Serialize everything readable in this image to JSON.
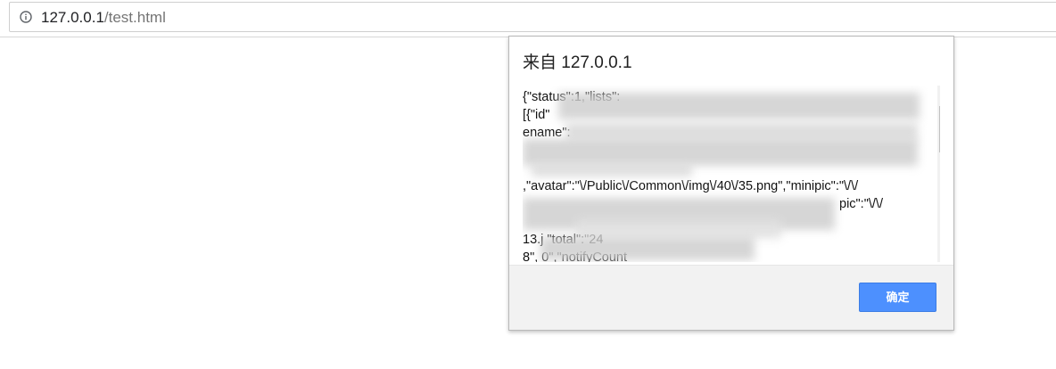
{
  "browser": {
    "url_host": "127.0.0.1",
    "url_path": "/test.html",
    "info_icon": "info-icon"
  },
  "dialog": {
    "title": "来自 127.0.0.1",
    "message_lines": [
      "{\"status\":1,\"lists\":",
      "[{\"id\"",
      "ename\":",
      "",
      "",
      ",\"avatar\":\"\\/Public\\/Common\\/img\\/40\\/35.png\",\"minipic\":\"\\/\\/",
      "pic\":\"\\/\\/",
      "",
      "13.j                              \"total\":\"24",
      "8\",                                          0\",\"notifyCount"
    ],
    "ok_label": "确定"
  },
  "colors": {
    "button_blue": "#4d90fe",
    "footer_gray": "#f2f2f2"
  }
}
